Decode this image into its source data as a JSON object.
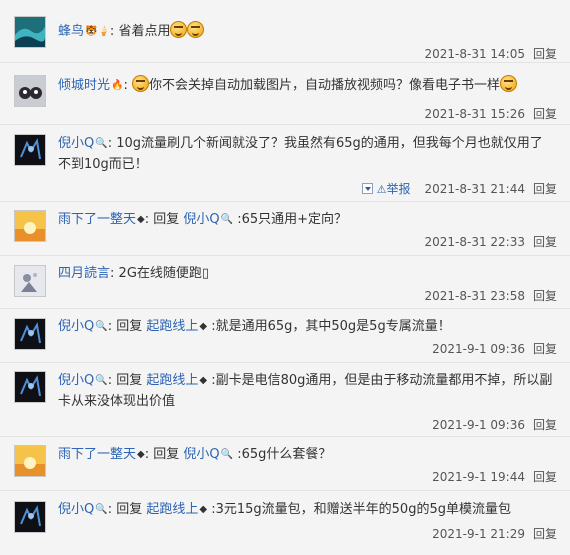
{
  "comments": [
    {
      "user": "蜂鸟",
      "badge": "🐯🍦",
      "sep": ":",
      "text": "省着点用",
      "time": "2021-8-31 14:05",
      "reply": "回复"
    },
    {
      "user": "倾城时光",
      "badge": "🔥",
      "sep": ":",
      "text": "你不会关掉自动加载图片，自动播放视频吗？像看电子书一样",
      "time": "2021-8-31 15:26",
      "reply": "回复"
    },
    {
      "user": "倪小Q",
      "badge": "🔍",
      "sep": ":",
      "text": "10g流量刷几个新闻就没了？我虽然有65g的通用，但我每个月也就仅用了不到10g而已！",
      "time": "2021-8-31 21:44",
      "reply": "回复",
      "report": "举报"
    },
    {
      "user": "雨下了一整天",
      "badge": "◆",
      "sep": ": 回复",
      "target": "倪小Q",
      "target_badge": "🔍",
      "text": ":65只通用+定向？",
      "time": "2021-8-31 22:33",
      "reply": "回复"
    },
    {
      "user": "四月読言",
      "badge": "",
      "sep": ":",
      "text": "2G在线随便跑▯",
      "time": "2021-8-31 23:58",
      "reply": "回复"
    },
    {
      "user": "倪小Q",
      "badge": "🔍",
      "sep": ": 回复",
      "target": "起跑线上",
      "target_badge": "◆",
      "text": ":就是通用65g，其中50g是5g专属流量！",
      "time": "2021-9-1 09:36",
      "reply": "回复"
    },
    {
      "user": "倪小Q",
      "badge": "🔍",
      "sep": ": 回复",
      "target": "起跑线上",
      "target_badge": "◆",
      "text": ":副卡是电信80g通用，但是由于移动流量都用不掉，所以副卡从来没体现出价值",
      "time": "2021-9-1 09:36",
      "reply": "回复"
    },
    {
      "user": "雨下了一整天",
      "badge": "◆",
      "sep": ": 回复",
      "target": "倪小Q",
      "target_badge": "🔍",
      "text": ":65g什么套餐？",
      "time": "2021-9-1 19:44",
      "reply": "回复"
    },
    {
      "user": "倪小Q",
      "badge": "🔍",
      "sep": ": 回复",
      "target": "起跑线上",
      "target_badge": "◆",
      "text": ":3元15g流量包，和赠送半年的50g的5g单模流量包",
      "time": "2021-9-1 21:29",
      "reply": "回复"
    }
  ]
}
